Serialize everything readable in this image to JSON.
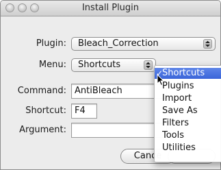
{
  "window": {
    "title": "Install Plugin"
  },
  "form": {
    "plugin_label": "Plugin:",
    "plugin_value": "Bleach_Correction",
    "menu_label": "Menu:",
    "menu_value": "Shortcuts",
    "command_label": "Command:",
    "command_value": "AntiBleach",
    "shortcut_label": "Shortcut:",
    "shortcut_value": "F4",
    "argument_label": "Argument:",
    "argument_value": ""
  },
  "buttons": {
    "cancel_label": "Cance"
  },
  "menu_dropdown": {
    "check_mark": "✓",
    "items": [
      "Shortcuts",
      "Plugins",
      "Import",
      "Save As",
      "Filters",
      "Tools",
      "Utilities"
    ],
    "selected": "Shortcuts"
  },
  "icons": {
    "close": "close-icon",
    "minimize": "minimize-icon",
    "zoom": "zoom-icon",
    "stepper": "up-down-arrows-icon",
    "cursor": "mouse-pointer-icon"
  },
  "colors": {
    "selection": "#3a64d9",
    "window_bg": "#ececec",
    "titlebar": "#d6d6d6"
  }
}
